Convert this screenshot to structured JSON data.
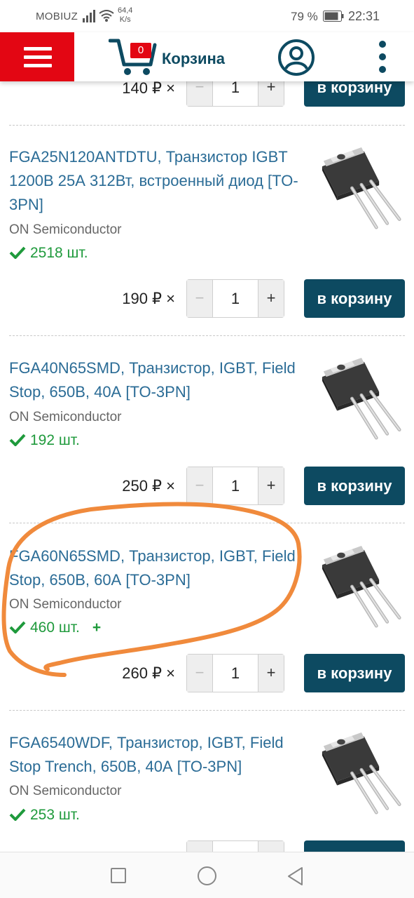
{
  "status_bar": {
    "carrier": "MOBIUZ",
    "speed_value": "64,4",
    "speed_unit": "K/s",
    "battery": "79 %",
    "time": "22:31"
  },
  "header": {
    "cart_count": "0",
    "cart_label": "Корзина"
  },
  "colors": {
    "brand_red": "#e30613",
    "primary_dark": "#0d4a61",
    "link_blue": "#2b6c96",
    "stock_green": "#1f9a3c",
    "annotation_orange": "#f08a3c"
  },
  "products": [
    {
      "title": "",
      "brand": "",
      "stock": "",
      "price": "140 ₽ ×",
      "qty": "1",
      "button": "в корзину"
    },
    {
      "title": "FGA25N120ANTDTU, Транзистор IGBT 1200В 25А 312Вт, встроенный диод [TO-3PN]",
      "brand": "ON Semiconductor",
      "stock": "2518 шт.",
      "price": "190 ₽ ×",
      "qty": "1",
      "button": "в корзину"
    },
    {
      "title": "FGA40N65SMD, Транзистор, IGBT, Field Stop, 650В, 40А [TO-3PN]",
      "brand": "ON Semiconductor",
      "stock": "192 шт.",
      "price": "250 ₽ ×",
      "qty": "1",
      "button": "в корзину"
    },
    {
      "title": "FGA60N65SMD, Транзистор, IGBT, Field Stop, 650В, 60А [TO-3PN]",
      "brand": "ON Semiconductor",
      "stock": "460 шт.",
      "stock_extra": "+",
      "price": "260 ₽ ×",
      "qty": "1",
      "button": "в корзину"
    },
    {
      "title": "FGA6540WDF, Транзистор, IGBT, Field Stop Trench, 650В, 40А [TO-3PN]",
      "brand": "ON Semiconductor",
      "stock": "253 шт.",
      "price": "",
      "qty": "",
      "button": ""
    }
  ],
  "qty_controls": {
    "minus": "−",
    "plus": "+"
  }
}
